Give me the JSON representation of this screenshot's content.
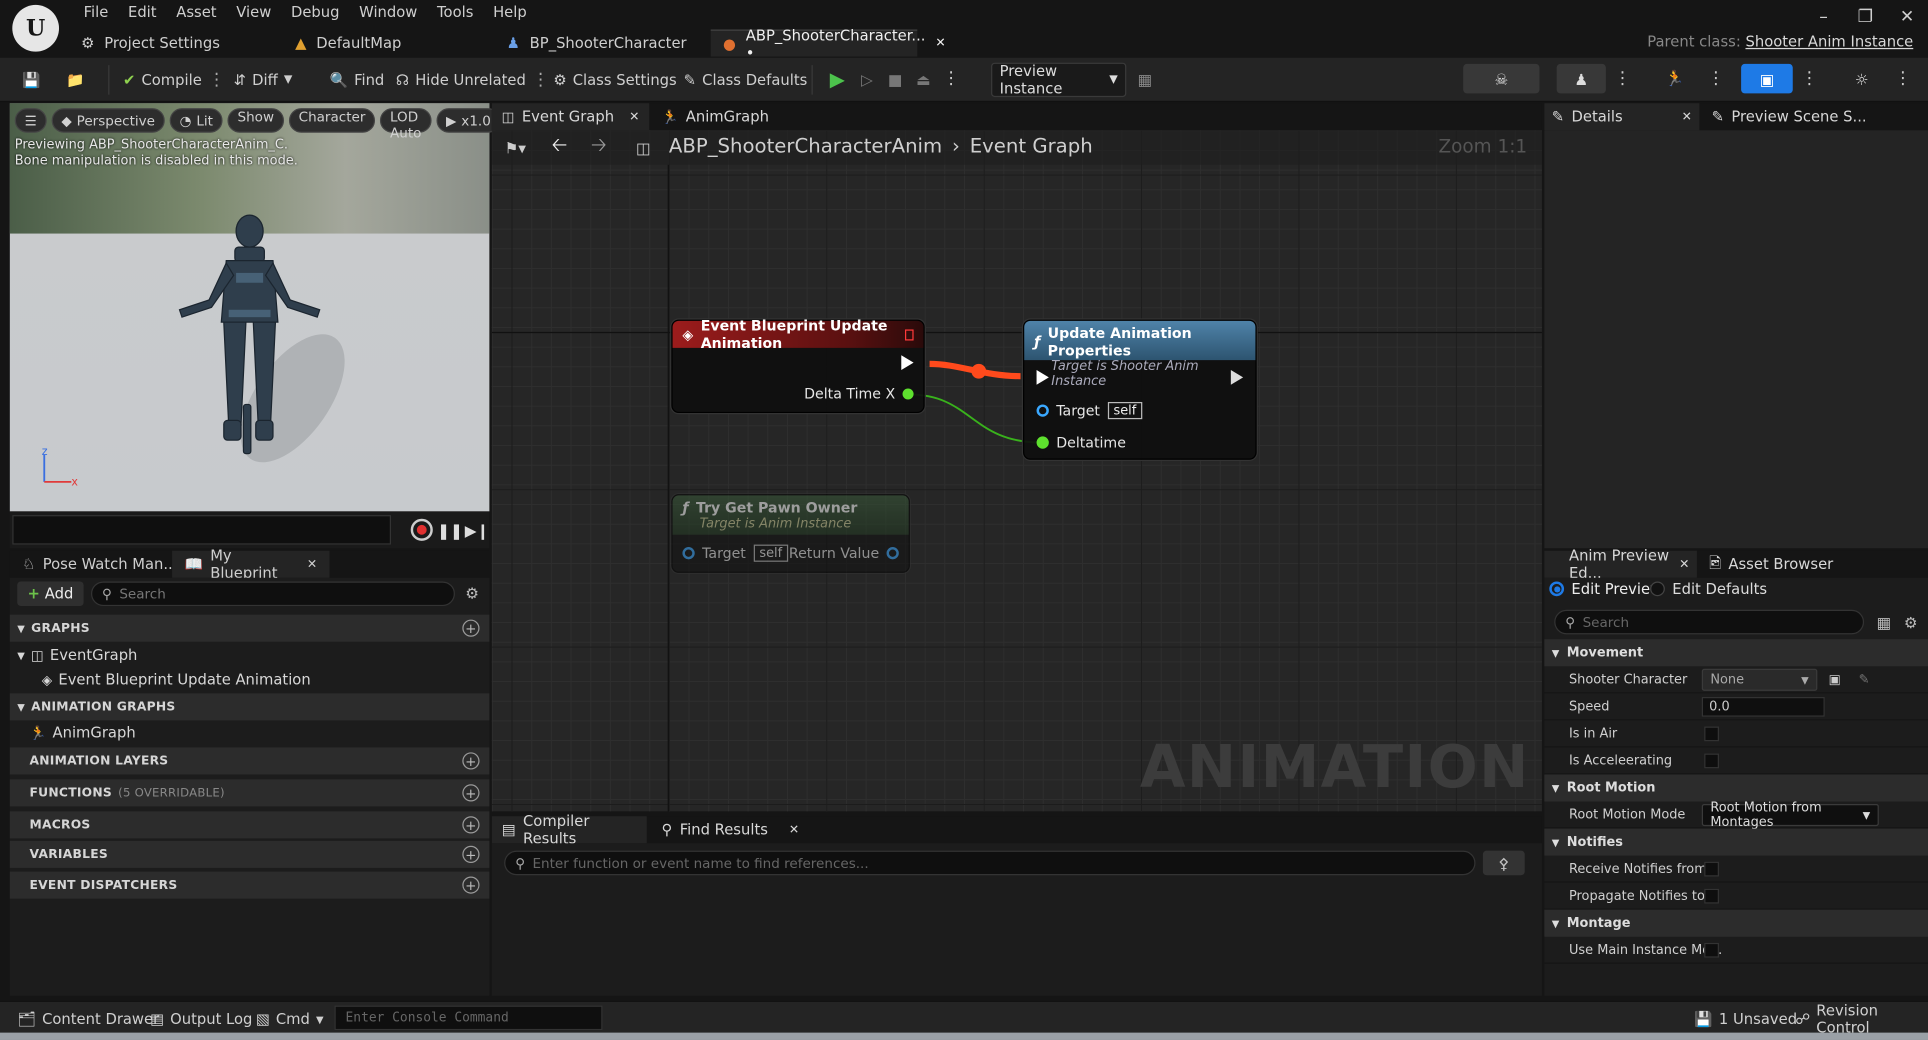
{
  "menu": [
    "File",
    "Edit",
    "Asset",
    "View",
    "Debug",
    "Window",
    "Tools",
    "Help"
  ],
  "doc_tabs": [
    {
      "label": "Project Settings",
      "icon": "gear-icon"
    },
    {
      "label": "DefaultMap",
      "icon": "map-icon"
    },
    {
      "label": "BP_ShooterCharacter",
      "icon": "character-icon"
    },
    {
      "label": "ABP_ShooterCharacter... •",
      "icon": "anim-blueprint-icon",
      "active": true
    }
  ],
  "parent_class": {
    "label": "Parent class:",
    "value": "Shooter Anim Instance"
  },
  "toolbar": {
    "compile": "Compile",
    "diff": "Diff",
    "find": "Find",
    "hide_unrelated": "Hide Unrelated",
    "class_settings": "Class Settings",
    "class_defaults": "Class Defaults",
    "preview_instance": "Preview Instance"
  },
  "viewport": {
    "perspective": "Perspective",
    "lit": "Lit",
    "show": "Show",
    "character": "Character",
    "lod": "LOD Auto",
    "speed": "x1.0",
    "msg1": "Previewing ABP_ShooterCharacterAnim_C.",
    "msg2": "Bone manipulation is disabled in this mode."
  },
  "left_tabs": {
    "pose_watch": "Pose Watch Man...",
    "my_blueprint": "My Blueprint"
  },
  "my_blueprint": {
    "add": "Add",
    "search_placeholder": "Search",
    "graphs": "GRAPHS",
    "event_graph": "EventGraph",
    "event_item": "Event Blueprint Update Animation",
    "anim_graphs": "ANIMATION GRAPHS",
    "anim_graph": "AnimGraph",
    "anim_layers": "ANIMATION LAYERS",
    "functions": "FUNCTIONS",
    "functions_note": "(5 OVERRIDABLE)",
    "macros": "MACROS",
    "variables": "VARIABLES",
    "dispatchers": "EVENT DISPATCHERS"
  },
  "graph_tabs": {
    "event_graph": "Event Graph",
    "anim_graph": "AnimGraph"
  },
  "breadcrumb": {
    "root": "ABP_ShooterCharacterAnim",
    "current": "Event Graph"
  },
  "zoom": "Zoom 1:1",
  "watermark": "ANIMATION",
  "nodes": {
    "event": {
      "title": "Event Blueprint Update Animation",
      "pin": "Delta Time X"
    },
    "update": {
      "title": "Update Animation Properties",
      "subtitle": "Target is Shooter Anim Instance",
      "target": "Target",
      "self": "self",
      "deltatime": "Deltatime"
    },
    "pawn": {
      "title": "Try Get Pawn Owner",
      "subtitle": "Target is Anim Instance",
      "target": "Target",
      "self": "self",
      "ret": "Return Value"
    }
  },
  "right_tabs": {
    "details": "Details",
    "preview_scene": "Preview Scene S..."
  },
  "anim_tabs": {
    "anim_preview": "Anim Preview Ed...",
    "asset_browser": "Asset Browser"
  },
  "anim_preview": {
    "edit_preview": "Edit Preview",
    "edit_defaults": "Edit Defaults",
    "search_placeholder": "Search",
    "movement": "Movement",
    "shooter_character": "Shooter Character",
    "none": "None",
    "speed": "Speed",
    "speed_val": "0.0",
    "in_air": "Is in Air",
    "accelerating": "Is Acceleerating",
    "root_motion": "Root Motion",
    "root_motion_mode": "Root Motion Mode",
    "root_motion_val": "Root Motion from Montages",
    "notifies": "Notifies",
    "receive_notifies": "Receive Notifies from...",
    "propagate_notifies": "Propagate Notifies to...",
    "montage": "Montage",
    "use_main": "Use Main Instance Mo..."
  },
  "bottom_tabs": {
    "compiler": "Compiler Results",
    "find": "Find Results"
  },
  "find_placeholder": "Enter function or event name to find references...",
  "status": {
    "content_drawer": "Content Drawer",
    "output_log": "Output Log",
    "cmd": "Cmd",
    "console_placeholder": "Enter Console Command",
    "unsaved": "1 Unsaved",
    "revision": "Revision Control"
  }
}
